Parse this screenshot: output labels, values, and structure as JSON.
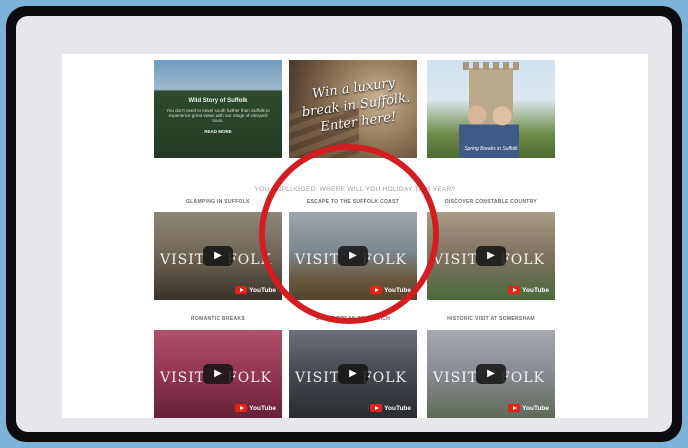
{
  "featured": [
    {
      "heading": "Wild Story of Suffolk",
      "body": "You don't need to travel south further than Suffolk to experience great views with our range of vineyard tours.",
      "cta": "READ MORE"
    },
    {
      "script_text": "Win a luxury break in Suffolk. Enter here!"
    },
    {
      "caption": "Spring Breaks in Suffolk"
    }
  ],
  "headline": "YOU UNPLUGGED: WHERE WILL YOU HOLIDAY THIS YEAR?",
  "videos": [
    {
      "label": "GLAMPING IN SUFFOLK",
      "brand_left": "VISIT",
      "brand_right": "FOLK",
      "provider": "YouTube"
    },
    {
      "label": "ESCAPE TO THE SUFFOLK COAST",
      "brand_left": "VISIT",
      "brand_right": "FOLK",
      "provider": "YouTube"
    },
    {
      "label": "DISCOVER CONSTABLE COUNTRY",
      "brand_left": "VISIT",
      "brand_right": "FOLK",
      "provider": "YouTube"
    },
    {
      "label": "ROMANTIC BREAKS",
      "brand_left": "VISIT",
      "brand_right": "FOLK",
      "provider": "YouTube"
    },
    {
      "label": "SHORT BREAK TO IPSWICH",
      "brand_left": "VISIT",
      "brand_right": "FOLK",
      "provider": "YouTube"
    },
    {
      "label": "HISTORIC VISIT AT SOMERSHAM",
      "brand_left": "VISIT",
      "brand_right": "FOLK",
      "provider": "YouTube"
    }
  ],
  "icons": {
    "play": "play-icon",
    "youtube": "youtube-logo-icon"
  },
  "colors": {
    "highlight_ring": "#d41d21",
    "frame": "#0c0c0e",
    "outer_bg": "#7fb2d8"
  }
}
